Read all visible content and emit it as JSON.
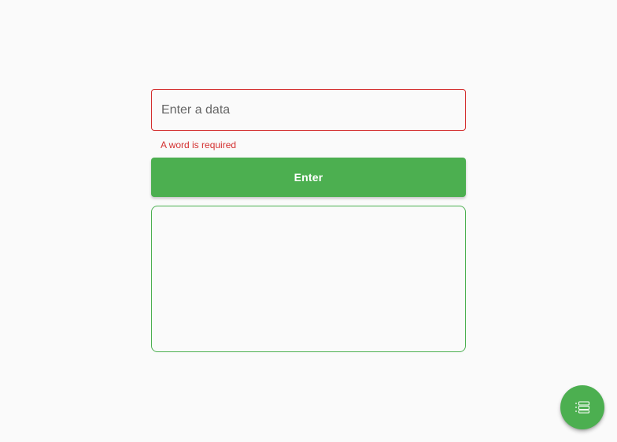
{
  "form": {
    "input_value": "",
    "input_placeholder": "Enter a data",
    "error_message": "A word is required",
    "enter_button_label": "Enter"
  },
  "result_box": {
    "content": ""
  },
  "fab": {
    "icon": "list-icon"
  },
  "colors": {
    "background": "#fafafa",
    "accent": "#4caf50",
    "error": "#d32f2f"
  }
}
